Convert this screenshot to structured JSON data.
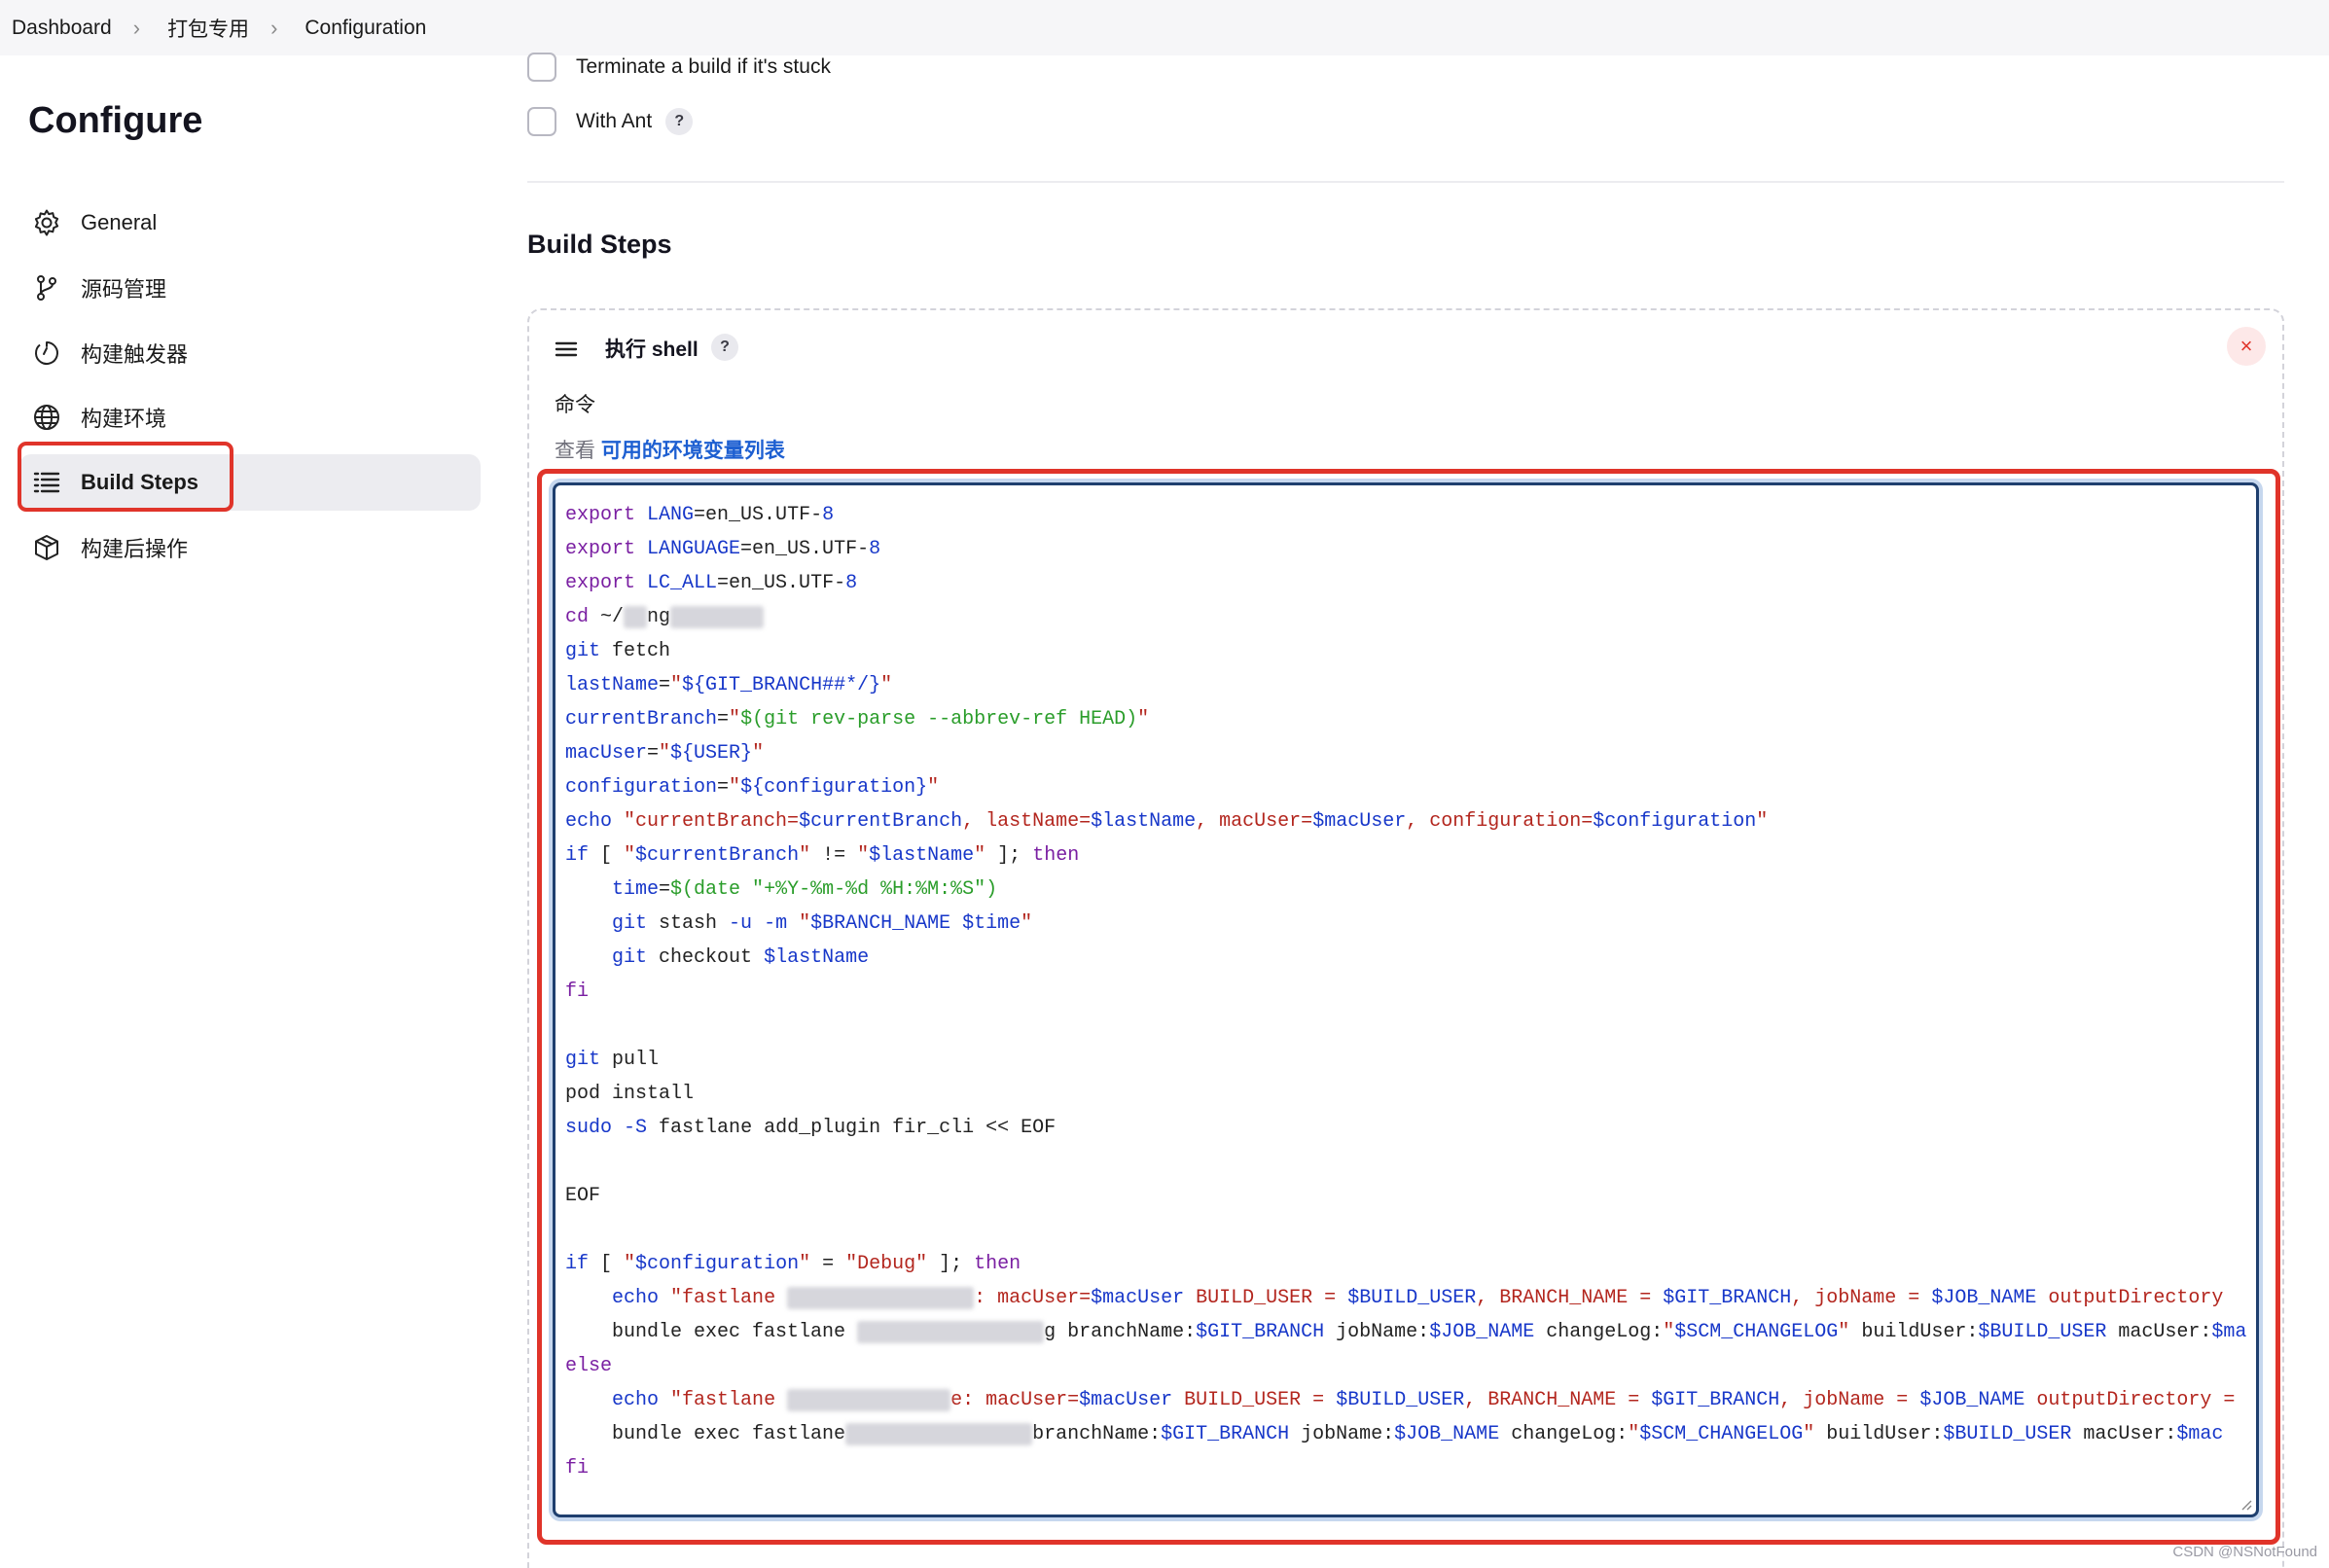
{
  "breadcrumb": [
    "Dashboard",
    "打包专用",
    "Configuration"
  ],
  "sidebar": {
    "title": "Configure",
    "items": [
      {
        "label": "General",
        "icon": "gear-icon"
      },
      {
        "label": "源码管理",
        "icon": "git-branch-icon"
      },
      {
        "label": "构建触发器",
        "icon": "clock-icon"
      },
      {
        "label": "构建环境",
        "icon": "globe-icon"
      },
      {
        "label": "Build Steps",
        "icon": "list-icon",
        "active": true
      },
      {
        "label": "构建后操作",
        "icon": "package-icon"
      }
    ]
  },
  "main": {
    "options": [
      {
        "label": "Terminate a build if it's stuck",
        "checked": false
      },
      {
        "label": "With Ant",
        "checked": false,
        "help": "?"
      }
    ],
    "section_title": "Build Steps",
    "step": {
      "title": "执行 shell",
      "help": "?",
      "close": "×",
      "field_label": "命令",
      "env_prefix": "查看",
      "env_link": "可用的环境变量列表"
    }
  },
  "code": [
    [
      [
        "kw",
        "export"
      ],
      [
        "pl",
        " "
      ],
      [
        "var",
        "LANG"
      ],
      [
        "pl",
        "=en_US.UTF-"
      ],
      [
        "num",
        "8"
      ]
    ],
    [
      [
        "kw",
        "export"
      ],
      [
        "pl",
        " "
      ],
      [
        "var",
        "LANGUAGE"
      ],
      [
        "pl",
        "=en_US.UTF-"
      ],
      [
        "num",
        "8"
      ]
    ],
    [
      [
        "kw",
        "export"
      ],
      [
        "pl",
        " "
      ],
      [
        "var",
        "LC_ALL"
      ],
      [
        "pl",
        "=en_US.UTF-"
      ],
      [
        "num",
        "8"
      ]
    ],
    [
      [
        "kw",
        "cd"
      ],
      [
        "pl",
        " ~/"
      ],
      [
        "blur",
        "xx"
      ],
      [
        "pl",
        "ng"
      ],
      [
        "blur",
        "xxxxxxxx"
      ]
    ],
    [
      [
        "var",
        "git"
      ],
      [
        "pl",
        " fetch"
      ]
    ],
    [
      [
        "var",
        "lastName"
      ],
      [
        "pl",
        "="
      ],
      [
        "str",
        "\""
      ],
      [
        "var",
        "${GIT_BRANCH##*/}"
      ],
      [
        "str",
        "\""
      ]
    ],
    [
      [
        "var",
        "currentBranch"
      ],
      [
        "pl",
        "="
      ],
      [
        "str",
        "\""
      ],
      [
        "cmd",
        "$(git rev-parse --abbrev-ref HEAD)"
      ],
      [
        "str",
        "\""
      ]
    ],
    [
      [
        "var",
        "macUser"
      ],
      [
        "pl",
        "="
      ],
      [
        "str",
        "\""
      ],
      [
        "var",
        "${USER}"
      ],
      [
        "str",
        "\""
      ]
    ],
    [
      [
        "var",
        "configuration"
      ],
      [
        "pl",
        "="
      ],
      [
        "str",
        "\""
      ],
      [
        "var",
        "${configuration}"
      ],
      [
        "str",
        "\""
      ]
    ],
    [
      [
        "var",
        "echo"
      ],
      [
        "pl",
        " "
      ],
      [
        "str",
        "\"currentBranch="
      ],
      [
        "var",
        "$currentBranch"
      ],
      [
        "str",
        ", lastName="
      ],
      [
        "var",
        "$lastName"
      ],
      [
        "str",
        ", macUser="
      ],
      [
        "var",
        "$macUser"
      ],
      [
        "str",
        ", configuration="
      ],
      [
        "var",
        "$configuration"
      ],
      [
        "str",
        "\""
      ]
    ],
    [
      [
        "var",
        "if"
      ],
      [
        "pl",
        " [ "
      ],
      [
        "str",
        "\""
      ],
      [
        "var",
        "$currentBranch"
      ],
      [
        "str",
        "\""
      ],
      [
        "pl",
        " != "
      ],
      [
        "str",
        "\""
      ],
      [
        "var",
        "$lastName"
      ],
      [
        "str",
        "\""
      ],
      [
        "pl",
        " ]; "
      ],
      [
        "kw",
        "then"
      ]
    ],
    [
      [
        "pl",
        "    "
      ],
      [
        "var",
        "time"
      ],
      [
        "pl",
        "="
      ],
      [
        "cmd",
        "$(date \"+%Y-%m-%d %H:%M:%S\")"
      ]
    ],
    [
      [
        "pl",
        "    "
      ],
      [
        "var",
        "git"
      ],
      [
        "pl",
        " stash "
      ],
      [
        "var",
        "-u"
      ],
      [
        "pl",
        " "
      ],
      [
        "var",
        "-m"
      ],
      [
        "pl",
        " "
      ],
      [
        "str",
        "\""
      ],
      [
        "var",
        "$BRANCH_NAME $time"
      ],
      [
        "str",
        "\""
      ]
    ],
    [
      [
        "pl",
        "    "
      ],
      [
        "var",
        "git"
      ],
      [
        "pl",
        " checkout "
      ],
      [
        "var",
        "$lastName"
      ]
    ],
    [
      [
        "kw",
        "fi"
      ]
    ],
    [],
    [
      [
        "var",
        "git"
      ],
      [
        "pl",
        " pull"
      ]
    ],
    [
      [
        "pl",
        "pod install"
      ]
    ],
    [
      [
        "var",
        "sudo"
      ],
      [
        "pl",
        " "
      ],
      [
        "var",
        "-S"
      ],
      [
        "pl",
        " fastlane add_plugin fir_cli << EOF"
      ]
    ],
    [],
    [
      [
        "pl",
        "EOF"
      ]
    ],
    [],
    [
      [
        "var",
        "if"
      ],
      [
        "pl",
        " [ "
      ],
      [
        "str",
        "\""
      ],
      [
        "var",
        "$configuration"
      ],
      [
        "str",
        "\""
      ],
      [
        "pl",
        " = "
      ],
      [
        "str",
        "\"Debug\""
      ],
      [
        "pl",
        " ]; "
      ],
      [
        "kw",
        "then"
      ]
    ],
    [
      [
        "pl",
        "    "
      ],
      [
        "var",
        "echo"
      ],
      [
        "pl",
        " "
      ],
      [
        "str",
        "\"fastlane "
      ],
      [
        "blur",
        "xxxxxxxxxxxxxxxx"
      ],
      [
        "str",
        ": macUser="
      ],
      [
        "var",
        "$macUser"
      ],
      [
        "str",
        " BUILD_USER = "
      ],
      [
        "var",
        "$BUILD_USER"
      ],
      [
        "str",
        ", BRANCH_NAME = "
      ],
      [
        "var",
        "$GIT_BRANCH"
      ],
      [
        "str",
        ", jobName = "
      ],
      [
        "var",
        "$JOB_NAME"
      ],
      [
        "str",
        " outputDirectory"
      ]
    ],
    [
      [
        "pl",
        "    bundle exec fastlane "
      ],
      [
        "blur",
        "xxxxxxxxxxxxxxxx"
      ],
      [
        "pl",
        "g branchName:"
      ],
      [
        "var",
        "$GIT_BRANCH"
      ],
      [
        "pl",
        " jobName:"
      ],
      [
        "var",
        "$JOB_NAME"
      ],
      [
        "pl",
        " changeLog:"
      ],
      [
        "str",
        "\""
      ],
      [
        "var",
        "$SCM_CHANGELOG"
      ],
      [
        "str",
        "\""
      ],
      [
        "pl",
        " buildUser:"
      ],
      [
        "var",
        "$BUILD_USER"
      ],
      [
        "pl",
        " macUser:"
      ],
      [
        "var",
        "$ma"
      ]
    ],
    [
      [
        "kw",
        "else"
      ]
    ],
    [
      [
        "pl",
        "    "
      ],
      [
        "var",
        "echo"
      ],
      [
        "pl",
        " "
      ],
      [
        "str",
        "\"fastlane "
      ],
      [
        "blur",
        "xxxxxxxxxxxxxx"
      ],
      [
        "str",
        "e: macUser="
      ],
      [
        "var",
        "$macUser"
      ],
      [
        "str",
        " BUILD_USER = "
      ],
      [
        "var",
        "$BUILD_USER"
      ],
      [
        "str",
        ", BRANCH_NAME = "
      ],
      [
        "var",
        "$GIT_BRANCH"
      ],
      [
        "str",
        ", jobName = "
      ],
      [
        "var",
        "$JOB_NAME"
      ],
      [
        "str",
        " outputDirectory ="
      ]
    ],
    [
      [
        "pl",
        "    bundle exec fastlane"
      ],
      [
        "blur",
        "xxxxxxxxxxxxxxxx"
      ],
      [
        "pl",
        "branchName:"
      ],
      [
        "var",
        "$GIT_BRANCH"
      ],
      [
        "pl",
        " jobName:"
      ],
      [
        "var",
        "$JOB_NAME"
      ],
      [
        "pl",
        " changeLog:"
      ],
      [
        "str",
        "\""
      ],
      [
        "var",
        "$SCM_CHANGELOG"
      ],
      [
        "str",
        "\""
      ],
      [
        "pl",
        " buildUser:"
      ],
      [
        "var",
        "$BUILD_USER"
      ],
      [
        "pl",
        " macUser:"
      ],
      [
        "var",
        "$mac"
      ]
    ],
    [
      [
        "kw",
        "fi"
      ]
    ]
  ],
  "watermark": "CSDN @NSNotFound",
  "colors": {
    "accent_red": "#e0342a",
    "link_blue": "#1d5fd1",
    "active_bg": "#ececf0",
    "editor_border": "#1f3f6e"
  }
}
